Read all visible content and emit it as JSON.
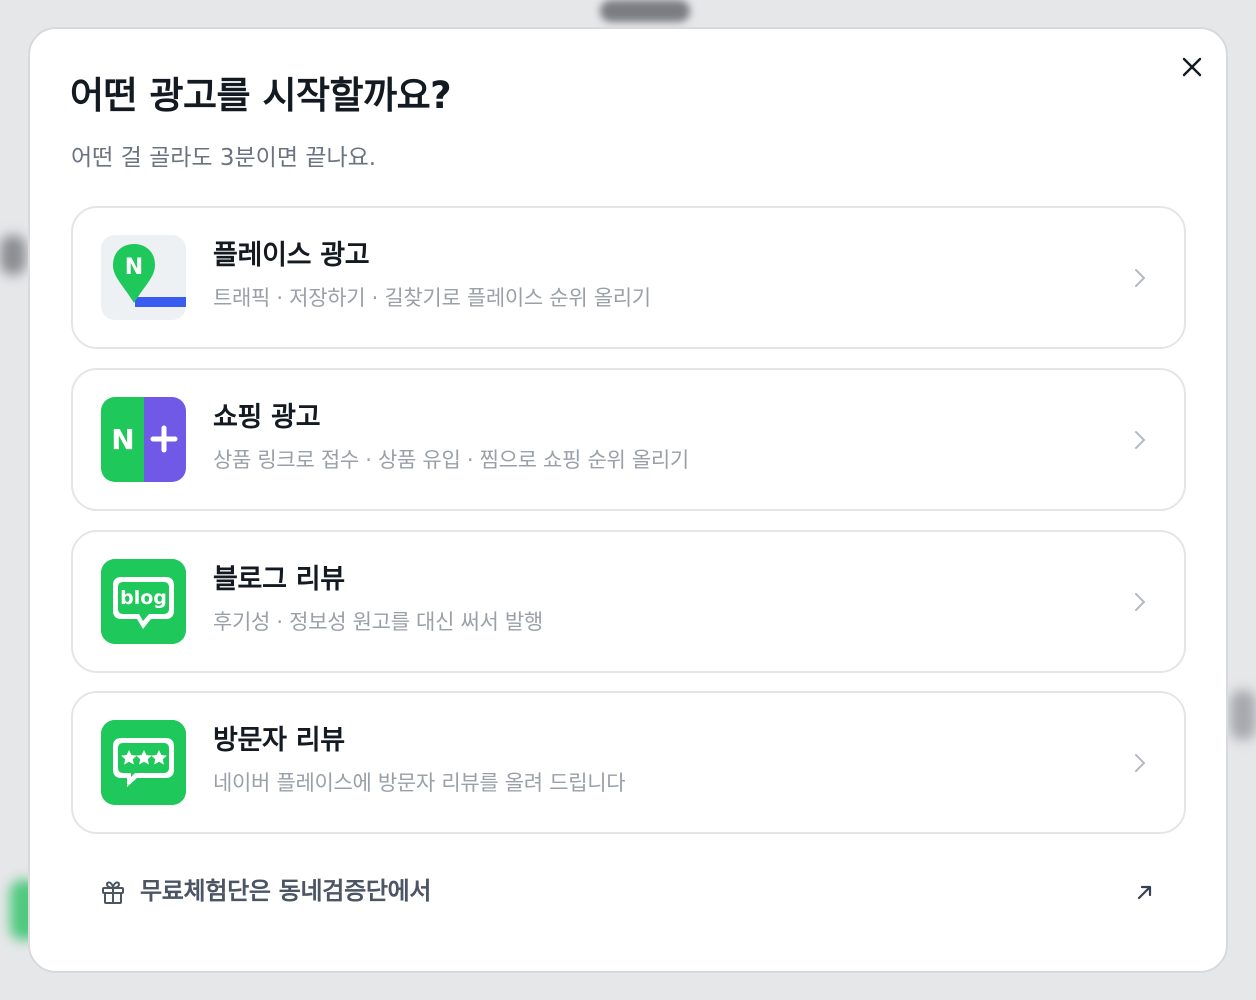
{
  "modal": {
    "title": "어떤 광고를 시작할까요?",
    "subtitle": "어떤 걸 골라도 3분이면 끝나요.",
    "close_icon": "close-icon"
  },
  "options": [
    {
      "title": "플레이스 광고",
      "description": "트래픽 · 저장하기 · 길찾기로 플레이스 순위 올리기",
      "icon": "naver-place-pin-icon"
    },
    {
      "title": "쇼핑 광고",
      "description": "상품 링크로 접수 · 상품 유입 · 찜으로 쇼핑 순위 올리기",
      "icon": "naver-plus-icon"
    },
    {
      "title": "블로그 리뷰",
      "description": "후기성 · 정보성 원고를 대신 써서 발행",
      "icon": "blog-icon",
      "icon_text": "blog"
    },
    {
      "title": "방문자 리뷰",
      "description": "네이버 플레이스에 방문자 리뷰를 올려 드립니다",
      "icon": "star-review-icon"
    }
  ],
  "footer": {
    "label": "무료체험단은 동네검증단에서",
    "icon": "gift-icon",
    "external_icon": "external-link-arrow-icon"
  },
  "colors": {
    "naver_green": "#1ec85a",
    "purple": "#7159e8",
    "blue_route": "#3b5cf0",
    "title": "#141a22",
    "muted": "#9aa0a8"
  }
}
